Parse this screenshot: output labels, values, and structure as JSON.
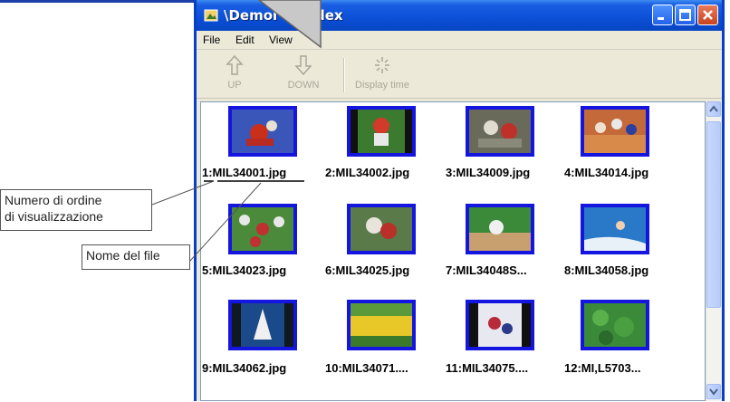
{
  "window": {
    "title": "\\Demol        dex",
    "controls": [
      "minimize-icon",
      "maximize-icon",
      "close-icon"
    ]
  },
  "menu": [
    "File",
    "Edit",
    "View"
  ],
  "toolbar": {
    "up": "UP",
    "down": "DOWN",
    "display_time": "Display time"
  },
  "thumbnails": [
    {
      "caption": "1:MIL34001.jpg"
    },
    {
      "caption": "2:MIL34002.jpg"
    },
    {
      "caption": "3:MIL34009.jpg"
    },
    {
      "caption": "4:MIL34014.jpg"
    },
    {
      "caption": "5:MIL34023.jpg"
    },
    {
      "caption": "6:MIL34025.jpg"
    },
    {
      "caption": "7:MIL34048S..."
    },
    {
      "caption": "8:MIL34058.jpg"
    },
    {
      "caption": "9:MIL34062.jpg"
    },
    {
      "caption": "10:MIL34071...."
    },
    {
      "caption": "11:MIL34075...."
    },
    {
      "caption": "12:MI,L5703..."
    }
  ],
  "annotations": {
    "order_number": "Numero di ordine\ndi visualizzazione",
    "order_line1": "Numero di ordine",
    "order_line2": "di visualizzazione",
    "file_name": "Nome del file"
  },
  "colors": {
    "titlebar": "#0a4fd6",
    "thumb_frame": "#1515e0",
    "window_body": "#ece9d8"
  }
}
